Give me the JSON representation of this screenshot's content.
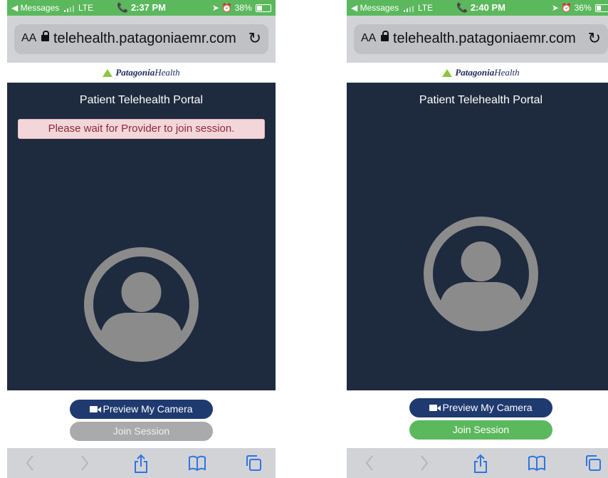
{
  "phones": [
    {
      "status": {
        "carrier": "◀ Messages",
        "network": "LTE",
        "time": "📞 2:37 PM",
        "battery_text": "38%",
        "battery_level": 0.38
      },
      "address": {
        "text_size_label": "AA",
        "url": "telehealth.patagoniaemr.com"
      },
      "brand": {
        "strong": "Patagonia",
        "rest": "Health"
      },
      "portal_title": "Patient Telehealth Portal",
      "wait_message": "Please wait for Provider to join session.",
      "preview_button": "Preview My Camera",
      "join_button": "Join Session",
      "join_state": "disabled"
    },
    {
      "status": {
        "carrier": "◀ Messages",
        "network": "LTE",
        "time": "📞 2:40 PM",
        "battery_text": "36%",
        "battery_level": 0.36
      },
      "address": {
        "text_size_label": "AA",
        "url": "telehealth.patagoniaemr.com"
      },
      "brand": {
        "strong": "Patagonia",
        "rest": "Health"
      },
      "portal_title": "Patient Telehealth Portal",
      "preview_button": "Preview My Camera",
      "join_button": "Join Session",
      "join_state": "enabled"
    }
  ],
  "icons": {
    "avatar": "person-avatar-icon",
    "back": "chevron-left-icon",
    "forward": "chevron-right-icon",
    "share": "share-icon",
    "bookmarks": "book-icon",
    "tabs": "tabs-icon",
    "camera": "video-camera-icon",
    "lock": "lock-icon",
    "reload": "reload-icon"
  },
  "colors": {
    "status_bar": "#5cb85c",
    "portal_bg": "#1e2a3d",
    "preview_button": "#1f3a6e",
    "join_enabled": "#5cb85c",
    "join_disabled": "#a9aaab",
    "wait_bg": "#f3d6d9",
    "wait_text": "#8a2a35",
    "brand_green": "#8cc63f"
  }
}
